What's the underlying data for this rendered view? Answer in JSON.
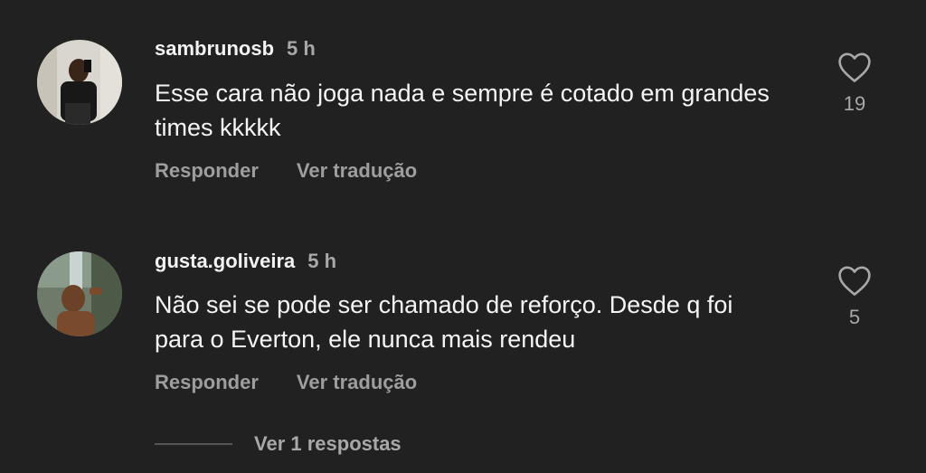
{
  "comments": [
    {
      "username": "sambrunosb",
      "time": "5 h",
      "text": "Esse cara não joga nada e sempre é cotado em grandes times kkkkk",
      "reply_label": "Responder",
      "translate_label": "Ver tradução",
      "likes": "19"
    },
    {
      "username": "gusta.goliveira",
      "time": "5 h",
      "text": "Não sei se pode ser chamado de reforço. Desde q foi para o Everton,  ele nunca mais rendeu",
      "reply_label": "Responder",
      "translate_label": "Ver tradução",
      "likes": "5"
    }
  ],
  "replies": {
    "label": "Ver 1 respostas"
  },
  "colors": {
    "background": "#212121",
    "text": "#f5f5f5",
    "muted": "#a8a8a8"
  },
  "icons": {
    "like": "heart-outline-icon"
  }
}
